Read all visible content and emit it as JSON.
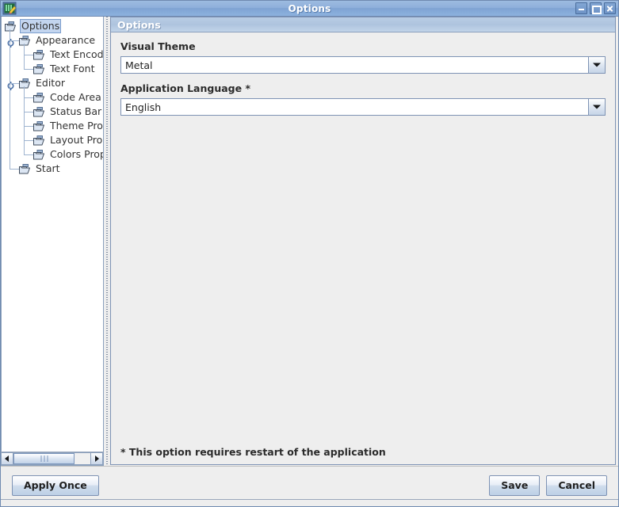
{
  "window": {
    "title": "Options",
    "icon": "app-icon",
    "buttons": {
      "minimize": "minimize-icon",
      "maximize": "maximize-icon",
      "close": "close-icon"
    }
  },
  "tree": {
    "nodes": [
      {
        "label": "Options",
        "depth": 0,
        "selected": true,
        "handle": "none"
      },
      {
        "label": "Appearance",
        "depth": 1,
        "selected": false,
        "handle": "expanded"
      },
      {
        "label": "Text Encoding",
        "depth": 2,
        "selected": false,
        "handle": "none"
      },
      {
        "label": "Text Font",
        "depth": 2,
        "selected": false,
        "handle": "none"
      },
      {
        "label": "Editor",
        "depth": 1,
        "selected": false,
        "handle": "expanded"
      },
      {
        "label": "Code Area",
        "depth": 2,
        "selected": false,
        "handle": "none"
      },
      {
        "label": "Status Bar",
        "depth": 2,
        "selected": false,
        "handle": "none"
      },
      {
        "label": "Theme Properties",
        "depth": 2,
        "selected": false,
        "handle": "none"
      },
      {
        "label": "Layout Properties",
        "depth": 2,
        "selected": false,
        "handle": "none"
      },
      {
        "label": "Colors Properties",
        "depth": 2,
        "selected": false,
        "handle": "none"
      },
      {
        "label": "Start",
        "depth": 1,
        "selected": false,
        "handle": "none"
      }
    ],
    "scrollbar": {
      "left_arrow": "scroll-left-icon",
      "right_arrow": "scroll-right-icon"
    }
  },
  "panel": {
    "header": "Options",
    "fields": [
      {
        "label": "Visual Theme",
        "value": "Metal"
      },
      {
        "label": "Application Language *",
        "value": "English"
      }
    ],
    "footnote": "* This option requires restart of the application"
  },
  "footer": {
    "apply_once": "Apply Once",
    "save": "Save",
    "cancel": "Cancel"
  },
  "colors": {
    "titlebar": "#8fb0db",
    "selection": "#c3d5ef",
    "panel_header": "#b8cce4",
    "background": "#eeeeee",
    "border": "#7e93b4"
  }
}
